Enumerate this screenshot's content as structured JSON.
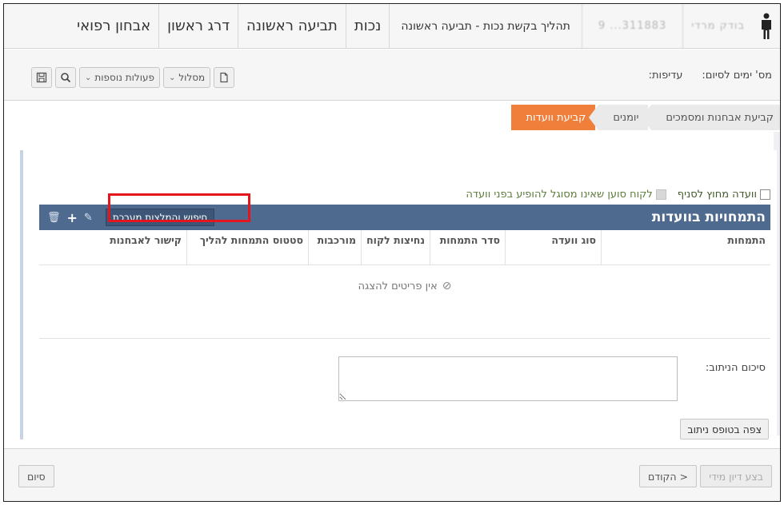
{
  "topbar": {
    "tabs": [
      "אבחון רפואי",
      "דרג ראשון",
      "תביעה ראשונה",
      "נכות"
    ],
    "process_title": "תהליך בקשת נכות - תביעה ראשונה",
    "blurred_id": "311883... 9",
    "blurred_name": "בודק מרדי"
  },
  "bar2": {
    "days_label": "מס' ימים לסיום:",
    "priority_label": "עדיפות:",
    "route_label": "מסלול",
    "more_actions_label": "פעולות נוספות"
  },
  "stepper": {
    "steps": [
      "קביעת אבחנות ומסמכים",
      "יומנים",
      "קביעת וועדות"
    ]
  },
  "panel": {
    "check1": "וועדה מחוץ לסניף",
    "check2": "לקוח סוען שאינו מסוגל להופיע בפני וועדה",
    "grid_title": "התמחויות בוועדות",
    "system_button": "חיפוש והמלצות מערכת",
    "columns": [
      "התמחות",
      "סוג וועדה",
      "סדר התמחות",
      "נחיצות לקוח",
      "מורכבות",
      "סטטוס התמחות להליך",
      "קישור לאבחנות"
    ],
    "empty_text": "אין פריטים להצגה",
    "summary_label": "סיכום הניתוב:",
    "view_button": "צפה בטופס ניתוב"
  },
  "footer": {
    "execute_label": "בצע דיון מידי",
    "prev_label": "< הקודם",
    "finish_label": "סיום"
  }
}
